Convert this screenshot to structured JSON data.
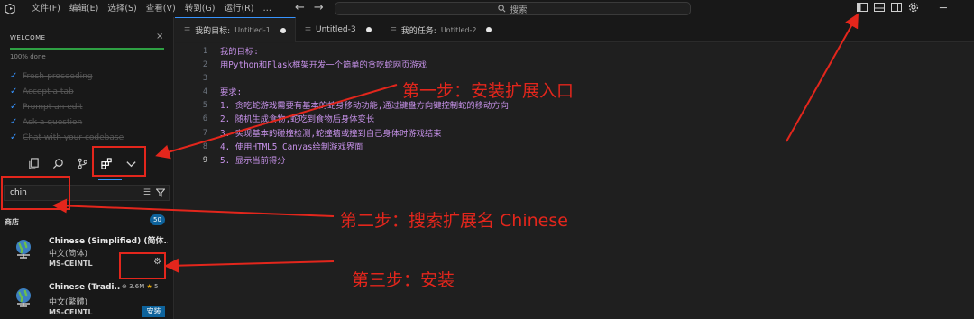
{
  "titlebar": {
    "menu": [
      "文件(F)",
      "编辑(E)",
      "选择(S)",
      "查看(V)",
      "转到(G)",
      "运行(R)",
      "…"
    ],
    "search_placeholder": "搜索",
    "nav_back": "←",
    "nav_forward": "→"
  },
  "welcome": {
    "title": "WELCOME",
    "close": "×",
    "progress": 1.0,
    "progress_text": "100% done",
    "tasks": [
      "Fresh-proceeding",
      "Accept a tab",
      "Prompt an edit",
      "Ask a question",
      "Chat with your codebase"
    ]
  },
  "extensions": {
    "search_value": "chin",
    "section_title": "商店",
    "count": "50",
    "items": [
      {
        "name": "Chinese (Simplified) (简体...",
        "desc": "中文(简体)",
        "publisher": "MS-CEINTL",
        "gear": "⚙"
      },
      {
        "name": "Chinese (Tradi...",
        "desc": "中文(繁體)",
        "publisher": "MS-CEINTL",
        "downloads": "3.6M",
        "rating": "5",
        "install_label": "安装"
      }
    ]
  },
  "tabs": [
    {
      "name": "我的目标:",
      "sub": "Untitled-1",
      "modified": true,
      "active": true
    },
    {
      "name": "Untitled-3",
      "sub": "",
      "modified": true,
      "active": false
    },
    {
      "name": "我的任务:",
      "sub": "Untitled-2",
      "modified": true,
      "active": false
    }
  ],
  "editor": {
    "line_numbers": [
      "1",
      "2",
      "3",
      "4",
      "5",
      "6",
      "7",
      "8",
      "9"
    ],
    "current_line": "9",
    "lines": [
      "我的目标:",
      "用Python和Flask框架开发一个简单的贪吃蛇网页游戏",
      "",
      "要求:",
      "1. 贪吃蛇游戏需要有基本的蛇身移动功能,通过键盘方向键控制蛇的移动方向",
      "2. 随机生成食物,蛇吃到食物后身体变长",
      "3. 实现基本的碰撞检测,蛇撞墙或撞到自己身体时游戏结束",
      "4. 使用HTML5 Canvas绘制游戏界面",
      "5. 显示当前得分"
    ]
  },
  "annotations": {
    "step1": "第一步：安装扩展入口",
    "step2": "第二步：搜索扩展名 Chinese",
    "step3": "第三步：安装",
    "color": "#e3261c"
  },
  "colors": {
    "accent": "#3794ff",
    "progress": "#2ea043",
    "install": "#0e639c",
    "code_text": "#c792ea"
  }
}
